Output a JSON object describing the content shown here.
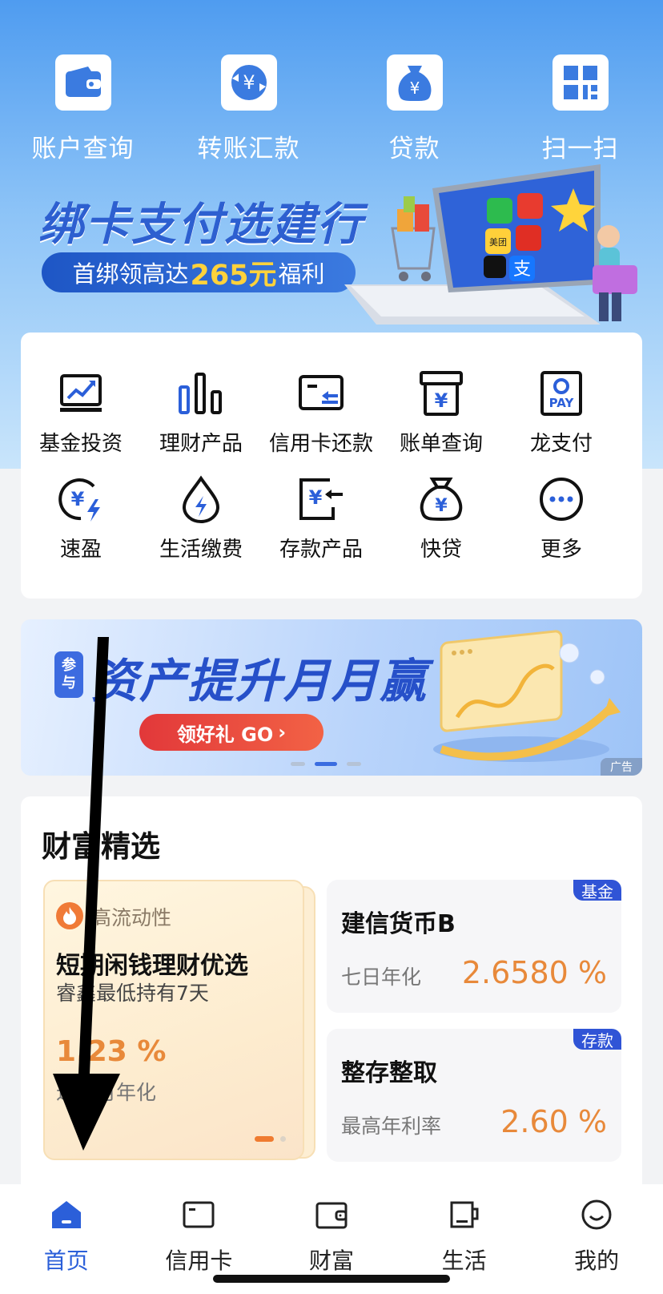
{
  "top_actions": [
    {
      "label": "账户查询",
      "icon": "wallet-icon"
    },
    {
      "label": "转账汇款",
      "icon": "transfer-icon"
    },
    {
      "label": "贷款",
      "icon": "money-bag-icon"
    },
    {
      "label": "扫一扫",
      "icon": "scan-icon"
    }
  ],
  "banner1": {
    "title": "绑卡支付选建行",
    "pill_prefix": "首绑领高达",
    "pill_highlight": "265元",
    "pill_suffix": "福利",
    "app_icons": [
      {
        "name": "wechat-icon",
        "color": "#2dbb4e"
      },
      {
        "name": "jd-icon",
        "color": "#e83b2f"
      },
      {
        "name": "meituan-icon",
        "color": "#ffd03a",
        "label": "美团"
      },
      {
        "name": "pinduoduo-icon",
        "color": "#e02e24"
      },
      {
        "name": "tiktok-icon",
        "color": "#111111"
      },
      {
        "name": "alipay-icon",
        "color": "#1677ff",
        "label": "支"
      }
    ]
  },
  "services": [
    {
      "label": "基金投资",
      "icon": "chart-trend-icon"
    },
    {
      "label": "理财产品",
      "icon": "bar-chart-icon"
    },
    {
      "label": "信用卡还款",
      "icon": "card-repay-icon"
    },
    {
      "label": "账单查询",
      "icon": "bill-box-icon"
    },
    {
      "label": "龙支付",
      "icon": "pay-icon",
      "icon_text": "PAY"
    },
    {
      "label": "速盈",
      "icon": "yuan-flash-icon"
    },
    {
      "label": "生活缴费",
      "icon": "water-drop-icon"
    },
    {
      "label": "存款产品",
      "icon": "deposit-icon"
    },
    {
      "label": "快贷",
      "icon": "quick-loan-icon"
    },
    {
      "label": "更多",
      "icon": "more-icon"
    }
  ],
  "banner2": {
    "tag_line1": "参",
    "tag_line2": "与",
    "title": "资产提升月月赢",
    "button": "领好礼 GO",
    "ad": "广告",
    "active_slide": 2,
    "slide_count": 3
  },
  "wealth": {
    "title": "财富精选",
    "feature": {
      "tag": "高流动性",
      "name": "短期闲钱理财优选",
      "sub": "睿鑫最低持有7天",
      "rate": "1.23 %",
      "rate_label": "近一月年化"
    },
    "products": [
      {
        "badge": "基金",
        "name": "建信货币B",
        "rate_label": "七日年化",
        "rate": "2.6580 %"
      },
      {
        "badge": "存款",
        "name": "整存整取",
        "rate_label": "最高年利率",
        "rate": "2.60 %"
      }
    ]
  },
  "tabbar": [
    {
      "label": "首页",
      "icon": "home-icon",
      "active": true
    },
    {
      "label": "信用卡",
      "icon": "credit-card-icon",
      "active": false
    },
    {
      "label": "财富",
      "icon": "wallet-tab-icon",
      "active": false
    },
    {
      "label": "生活",
      "icon": "cup-icon",
      "active": false
    },
    {
      "label": "我的",
      "icon": "profile-icon",
      "active": false
    }
  ],
  "colors": {
    "accent_blue": "#2b5fd9",
    "rate_orange": "#e8893a",
    "pill_yellow": "#ffd23b"
  }
}
